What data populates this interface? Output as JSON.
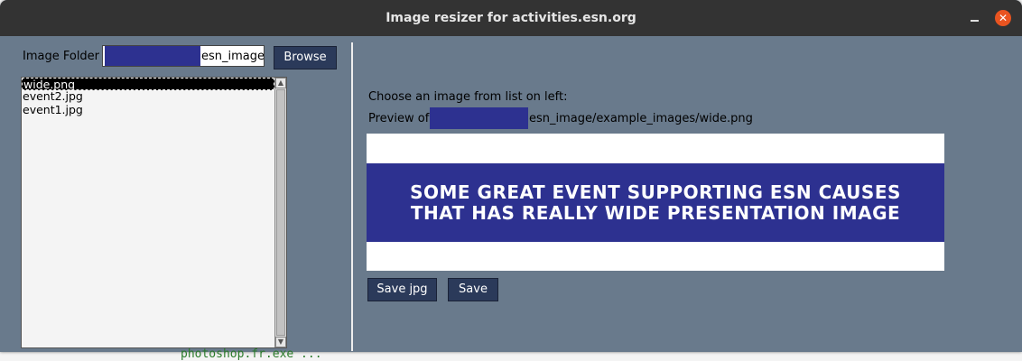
{
  "window": {
    "title": "Image resizer for activities.esn.org",
    "minimize_icon": "minimize-icon",
    "close_icon": "close-icon",
    "minimize_glyph": "",
    "close_glyph": "✕"
  },
  "left_panel": {
    "folder_label": "Image Folder",
    "folder_value": "esn_image/(",
    "browse_label": "Browse",
    "files": [
      "wide.png",
      "event2.jpg",
      "event1.jpg"
    ],
    "selected_index": 0
  },
  "right_panel": {
    "choose_label": "Choose an image from list on left:",
    "preview_label": "Preview of:",
    "preview_path": "esn_image/example_images/wide.png",
    "preview_banner": {
      "line1": "SOME GREAT EVENT SUPPORTING ESN CAUSES",
      "line2": "THAT HAS REALLY WIDE PRESENTATION IMAGE"
    },
    "save_jpg_label": "Save jpg",
    "save_label": "Save"
  },
  "colors": {
    "window_bg": "#697a8c",
    "titlebar_bg": "#333333",
    "close_button": "#e95420",
    "redaction": "#2d3190",
    "button_bg": "#2b3a5a"
  }
}
